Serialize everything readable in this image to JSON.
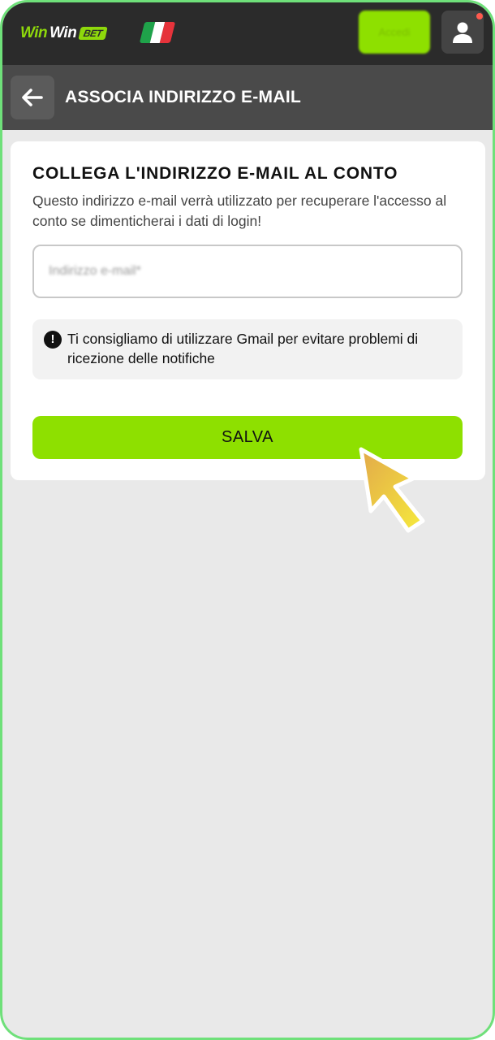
{
  "brand": {
    "logo_part1": "Win",
    "logo_part2": "Win",
    "logo_bet": "BET",
    "accent": "#8ee000",
    "frame": "#6fe07a"
  },
  "topbar": {
    "login_label": "Accedi",
    "flag": "italy-flag-icon"
  },
  "subheader": {
    "title": "ASSOCIA INDIRIZZO E-MAIL"
  },
  "card": {
    "title": "COLLEGA L'INDIRIZZO E-MAIL AL CONTO",
    "description": "Questo indirizzo e-mail verrà utilizzato per recuperare l'accesso al conto se dimenticherai i dati di login!",
    "email_placeholder": "Indirizzo e-mail*",
    "tip": "Ti consigliamo di utilizzare Gmail per evitare problemi di ricezione delle notifiche",
    "save_label": "SALVA"
  }
}
